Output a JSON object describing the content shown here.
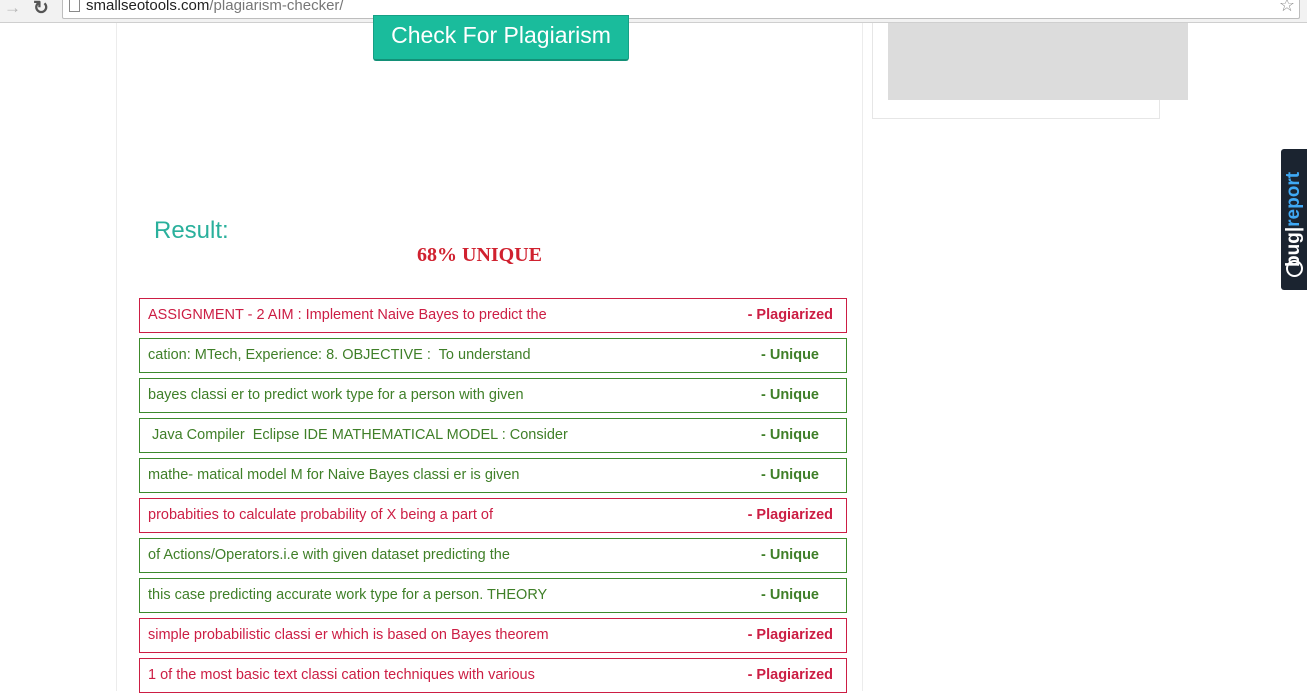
{
  "browser": {
    "url_domain": "smallseotools.com",
    "url_path": "/plagiarism-checker/",
    "icons": {
      "forward": "arrow-right-icon",
      "reload": "reload-icon",
      "page": "page-icon",
      "bookmark": "star-icon"
    }
  },
  "tool": {
    "check_button_label": "Check For Plagiarism",
    "result_label": "Result:",
    "score_text": "68% UNIQUE",
    "colors": {
      "button": "#1abc9c",
      "plagiarized": "#cc1e44",
      "unique": "#3f7f28",
      "score": "#d0212f"
    }
  },
  "bugreport": {
    "part1": "bug",
    "part2": "report"
  },
  "results": [
    {
      "text": "ASSIGNMENT - 2 AIM : Implement Naive Bayes to predict the",
      "status": "- Plagiarized",
      "type": "plagiarized"
    },
    {
      "text": "cation: MTech, Experience: 8. OBJECTIVE :  To understand",
      "status": "- Unique",
      "type": "unique"
    },
    {
      "text": "bayes classi er to predict work type for a person with given",
      "status": "- Unique",
      "type": "unique"
    },
    {
      "text": " Java Compiler  Eclipse IDE MATHEMATICAL MODEL : Consider",
      "status": "- Unique",
      "type": "unique"
    },
    {
      "text": "mathe- matical model M for Naive Bayes classi er is given",
      "status": "- Unique",
      "type": "unique"
    },
    {
      "text": "probabities to calculate probability of X being a part of",
      "status": "- Plagiarized",
      "type": "plagiarized"
    },
    {
      "text": "of Actions/Operators.i.e with given dataset predicting the",
      "status": "- Unique",
      "type": "unique"
    },
    {
      "text": "this case predicting accurate work type for a person. THEORY",
      "status": "- Unique",
      "type": "unique"
    },
    {
      "text": "simple probabilistic classi er which is based on Bayes theorem",
      "status": "- Plagiarized",
      "type": "plagiarized"
    },
    {
      "text": "1 of the most basic text classi cation techniques with various",
      "status": "- Plagiarized",
      "type": "plagiarized"
    }
  ]
}
